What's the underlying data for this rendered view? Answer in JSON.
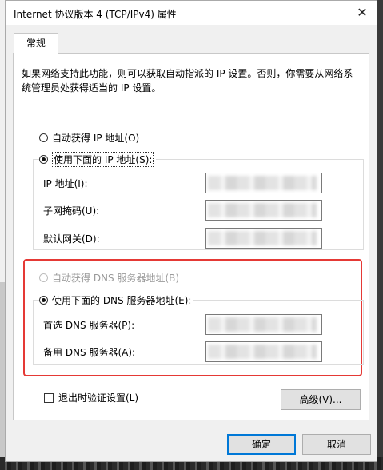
{
  "window": {
    "title": "Internet 协议版本 4 (TCP/IPv4) 属性",
    "close_glyph": "✕"
  },
  "tabs": [
    {
      "label": "常规"
    }
  ],
  "description": "如果网络支持此功能，则可以获取自动指派的 IP 设置。否则，你需要从网络系统管理员处获得适当的 IP 设置。",
  "ip": {
    "auto_label": "自动获得 IP 地址(O)",
    "manual_label": "使用下面的 IP 地址(S):",
    "selected": "manual",
    "fields": [
      {
        "label": "IP 地址(I):"
      },
      {
        "label": "子网掩码(U):"
      },
      {
        "label": "默认网关(D):"
      }
    ]
  },
  "dns": {
    "auto_label": "自动获得 DNS 服务器地址(B)",
    "manual_label": "使用下面的 DNS 服务器地址(E):",
    "selected": "manual",
    "fields": [
      {
        "label": "首选 DNS 服务器(P):"
      },
      {
        "label": "备用 DNS 服务器(A):"
      }
    ],
    "highlight_color": "#e53935"
  },
  "validate_label": "退出时验证设置(L)",
  "advanced_label": "高级(V)...",
  "ok_label": "确定",
  "cancel_label": "取消",
  "accent_color": "#0078d7"
}
